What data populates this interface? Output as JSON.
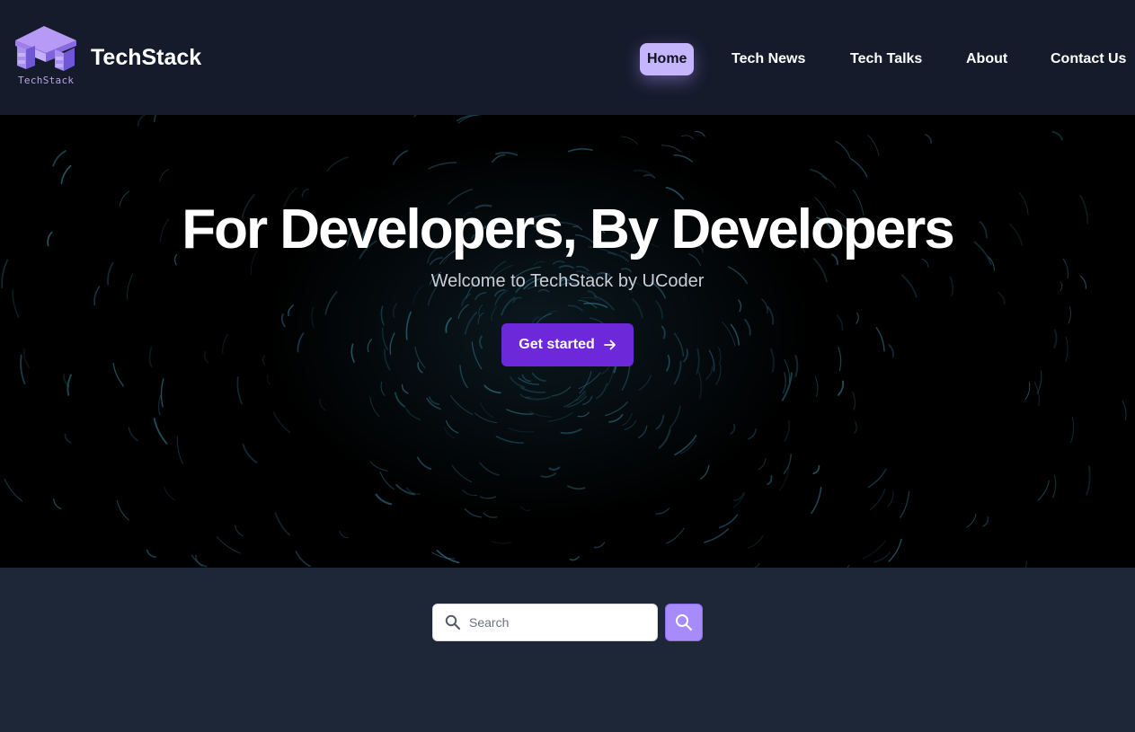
{
  "header": {
    "brand": "TechStack",
    "logo_caption": "TechStack",
    "logo_icon": "stacked-cubes-logo"
  },
  "nav": {
    "items": [
      {
        "label": "Home",
        "active": true
      },
      {
        "label": "Tech News",
        "active": false
      },
      {
        "label": "Tech Talks",
        "active": false
      },
      {
        "label": "About",
        "active": false
      },
      {
        "label": "Contact Us",
        "active": false
      }
    ]
  },
  "hero": {
    "title": "For Developers, By Developers",
    "subtitle": "Welcome to TechStack by UCoder",
    "cta_label": "Get started",
    "cta_icon": "arrow-right-icon"
  },
  "search": {
    "placeholder": "Search",
    "value": "",
    "icon": "search-icon"
  },
  "colors": {
    "header_bg": "#151b2b",
    "page_bg": "#1e2738",
    "accent": "#6d28d9",
    "active_nav": "#c4b5fd",
    "search_button": "#a78bfa"
  }
}
